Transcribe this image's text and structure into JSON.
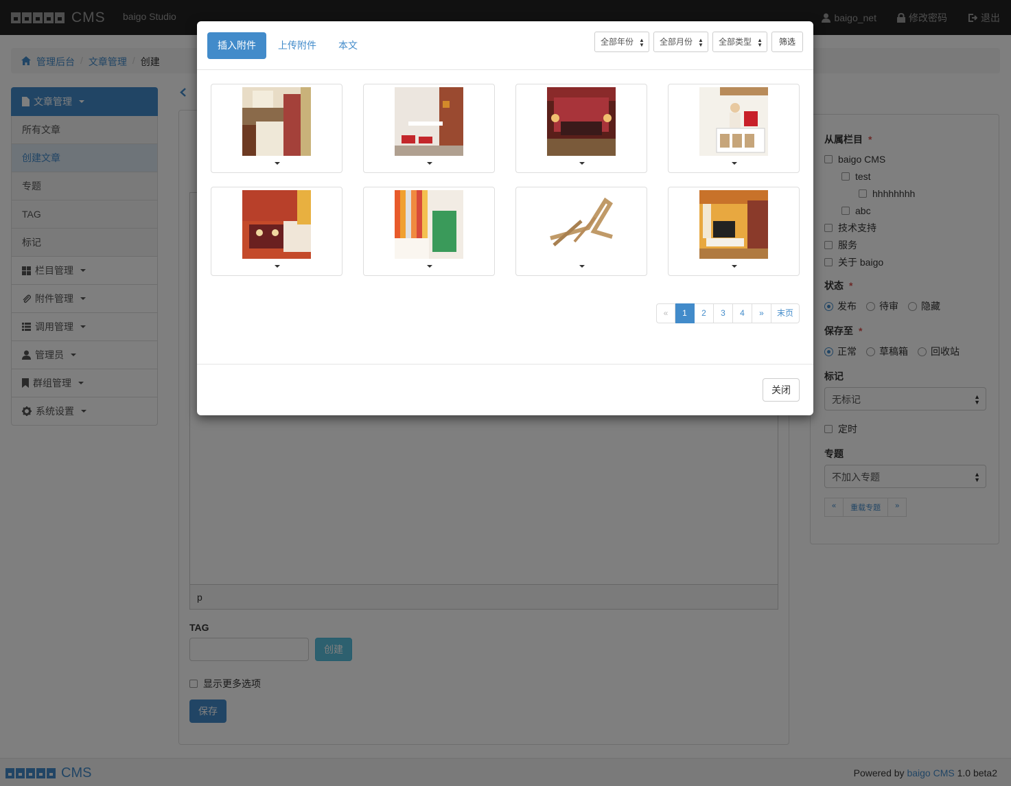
{
  "navbar": {
    "brand": "CMS",
    "studio": "baigo Studio",
    "user": "baigo_net",
    "change_password": "修改密码",
    "logout": "退出"
  },
  "breadcrumb": {
    "home": "管理后台",
    "section": "文章管理",
    "current": "创建"
  },
  "sidebar": {
    "items": [
      {
        "label": "文章管理",
        "icon": "file-icon"
      },
      {
        "label": "所有文章"
      },
      {
        "label": "创建文章"
      },
      {
        "label": "专题"
      },
      {
        "label": "TAG"
      },
      {
        "label": "标记"
      },
      {
        "label": "栏目管理",
        "icon": "grid-icon"
      },
      {
        "label": "附件管理",
        "icon": "paperclip-icon"
      },
      {
        "label": "调用管理",
        "icon": "list-icon"
      },
      {
        "label": "管理员",
        "icon": "user-icon"
      },
      {
        "label": "群组管理",
        "icon": "bookmark-icon"
      },
      {
        "label": "系统设置",
        "icon": "gear-icon"
      }
    ]
  },
  "editor": {
    "status_path": "p"
  },
  "tag": {
    "label": "TAG",
    "create_button": "创建"
  },
  "more_options": "显示更多选项",
  "save_button": "保存",
  "right_panel": {
    "category_label": "从属栏目",
    "categories": [
      "baigo CMS",
      "test",
      "hhhhhhhh",
      "abc",
      "技术支持",
      "服务",
      "关于 baigo"
    ],
    "status_label": "状态",
    "status_options": [
      "发布",
      "待审",
      "隐藏"
    ],
    "status_selected": "发布",
    "save_to_label": "保存至",
    "save_to_options": [
      "正常",
      "草稿箱",
      "回收站"
    ],
    "save_to_selected": "正常",
    "mark_label": "标记",
    "mark_value": "无标记",
    "schedule_label": "定时",
    "topic_label": "专题",
    "topic_value": "不加入专题",
    "reload_topic": "重载专题",
    "prev": "«",
    "next": "»"
  },
  "footer": {
    "brand": "CMS",
    "powered_prefix": "Powered by",
    "powered_link": "baigo CMS",
    "version": "1.0 beta2"
  },
  "modal": {
    "tabs": [
      "插入附件",
      "上传附件",
      "本文"
    ],
    "active_tab": "插入附件",
    "filters": [
      "全部年份",
      "全部月份",
      "全部类型"
    ],
    "filter_button": "筛选",
    "thumbnails": [
      {
        "name": "kitchen-photo"
      },
      {
        "name": "breakfast-bar-photo"
      },
      {
        "name": "red-bedroom-photo"
      },
      {
        "name": "shelf-reading-photo"
      },
      {
        "name": "dining-table-photo"
      },
      {
        "name": "striped-wall-room-photo"
      },
      {
        "name": "wooden-chair-photo"
      },
      {
        "name": "living-room-tv-photo"
      }
    ],
    "pagination": [
      "«",
      "1",
      "2",
      "3",
      "4",
      "»",
      "末页"
    ],
    "current_page": "1",
    "close_button": "关闭"
  },
  "colors": {
    "primary": "#428bca",
    "navbar_bg": "#222222",
    "info": "#5bc0de",
    "danger": "#d9534f"
  }
}
